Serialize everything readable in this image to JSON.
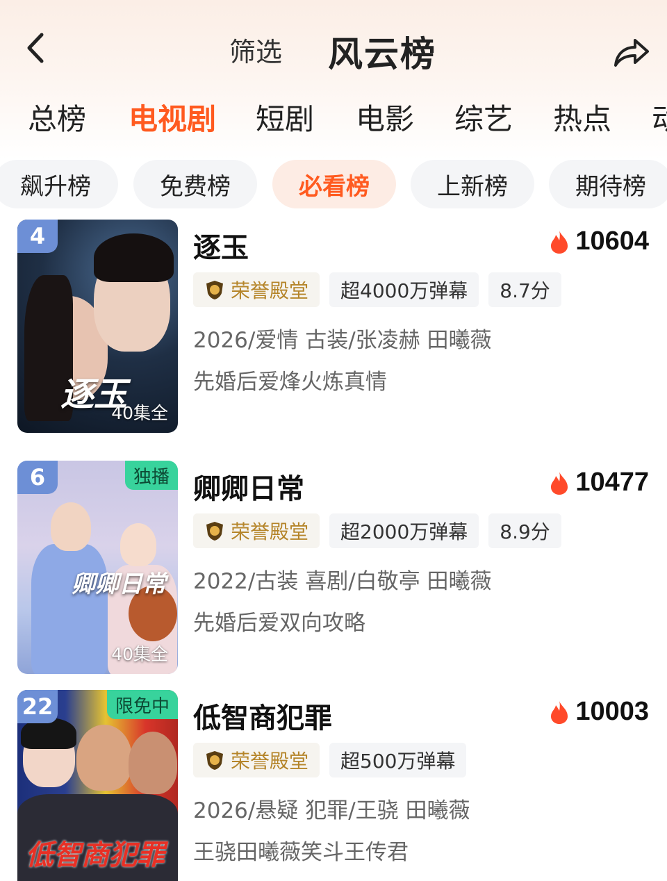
{
  "header": {
    "filter_label": "筛选",
    "title": "风云榜"
  },
  "category_tabs": [
    {
      "label": "总榜",
      "active": false
    },
    {
      "label": "电视剧",
      "active": true
    },
    {
      "label": "短剧",
      "active": false
    },
    {
      "label": "电影",
      "active": false
    },
    {
      "label": "综艺",
      "active": false
    },
    {
      "label": "热点",
      "active": false
    },
    {
      "label": "动",
      "active": false
    }
  ],
  "sub_tabs": [
    {
      "label": "飙升榜",
      "active": false
    },
    {
      "label": "免费榜",
      "active": false
    },
    {
      "label": "必看榜",
      "active": true
    },
    {
      "label": "上新榜",
      "active": false
    },
    {
      "label": "期待榜",
      "active": false
    }
  ],
  "items": [
    {
      "rank": "4",
      "corner_tag": "",
      "poster_text": "逐玉",
      "episodes": "40集全",
      "title": "逐玉",
      "heat": "10604",
      "honor": "荣誉殿堂",
      "danmaku": "超4000万弹幕",
      "score": "8.7分",
      "meta": "2026/爱情 古装/张凌赫 田曦薇",
      "desc": "先婚后爱烽火炼真情"
    },
    {
      "rank": "6",
      "corner_tag": "独播",
      "poster_text": "卿卿日常",
      "episodes": "40集全",
      "title": "卿卿日常",
      "heat": "10477",
      "honor": "荣誉殿堂",
      "danmaku": "超2000万弹幕",
      "score": "8.9分",
      "meta": "2022/古装 喜剧/白敬亭 田曦薇",
      "desc": "先婚后爱双向攻略"
    },
    {
      "rank": "22",
      "corner_tag": "限免中",
      "poster_text": "低智商犯罪",
      "episodes": "",
      "title": "低智商犯罪",
      "heat": "10003",
      "honor": "荣誉殿堂",
      "danmaku": "超500万弹幕",
      "score": "",
      "meta": "2026/悬疑 犯罪/王骁 田曦薇",
      "desc": "王骁田曦薇笑斗王传君"
    }
  ],
  "colors": {
    "accent": "#ff5a1f",
    "rank_badge": "#6d8fd6",
    "corner_tag": "#38d39c",
    "honor_text": "#b5852a",
    "flame": "#ff4a2a"
  },
  "icons": {
    "back": "chevron-left-icon",
    "share": "share-arrow-icon",
    "heat": "flame-icon",
    "honor": "shield-badge-icon"
  }
}
